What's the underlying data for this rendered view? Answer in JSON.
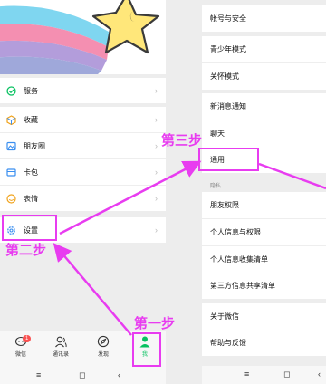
{
  "left_menu": {
    "items": [
      {
        "label": "服务"
      },
      {
        "label": "收藏"
      },
      {
        "label": "朋友圈"
      },
      {
        "label": "卡包"
      },
      {
        "label": "表情"
      },
      {
        "label": "设置"
      }
    ],
    "chevron": "›"
  },
  "tabbar": {
    "tabs": [
      {
        "label": "微信",
        "icon": "chat-icon",
        "badge": "1"
      },
      {
        "label": "通讯录",
        "icon": "contacts-icon"
      },
      {
        "label": "发现",
        "icon": "compass-icon"
      },
      {
        "label": "我",
        "icon": "person-icon",
        "active": true
      }
    ]
  },
  "system_nav": {
    "menu": "≡",
    "home": "◻",
    "back": "‹"
  },
  "right_menu": {
    "items": [
      {
        "label": "帐号与安全"
      },
      {
        "label": "青少年模式"
      },
      {
        "label": "关怀模式"
      },
      {
        "label": "新消息通知"
      },
      {
        "label": "聊天"
      },
      {
        "label": "通用"
      },
      {
        "label": "朋友权限"
      },
      {
        "label": "个人信息与权限"
      },
      {
        "label": "个人信息收集清单"
      },
      {
        "label": "第三方信息共享清单"
      },
      {
        "label": "关于微信"
      },
      {
        "label": "帮助与反馈"
      }
    ],
    "section_privacy": "隐私"
  },
  "annotations": {
    "step1": "第一步",
    "step2": "第二步",
    "step3": "第三步"
  },
  "colors": {
    "accent_magenta": "#e83cf0",
    "wechat_green": "#07c160",
    "badge_red": "#fa5151"
  }
}
